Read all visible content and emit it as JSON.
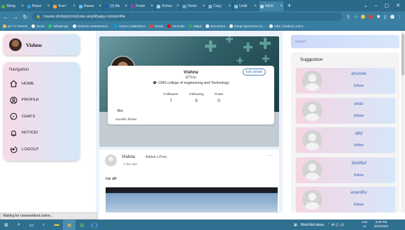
{
  "browser": {
    "tabs": [
      {
        "title": "String",
        "color": "#4caf50"
      },
      {
        "title": "React",
        "color": "#2b9de8"
      },
      {
        "title": "'from'",
        "color": "#f2a33a"
      },
      {
        "title": "Rewar",
        "color": "#66c0f4"
      },
      {
        "title": "(3) Me",
        "color": "#0a66c2"
      },
      {
        "title": "Fronti",
        "color": "#8e44ad"
      },
      {
        "title": "Vishnu",
        "color": "#9ad0ec"
      },
      {
        "title": "Home",
        "color": "#6aa9d0"
      },
      {
        "title": "Copy",
        "color": "#7fb3d5"
      },
      {
        "title": "Untitl",
        "color": "#88c0e0"
      },
      {
        "title": "NEW",
        "color": "#b0d4ea"
      }
    ],
    "active_tab_index": 10,
    "new_tab_label": "+",
    "window_controls": [
      "⌄",
      "–",
      "▢",
      "✕"
    ],
    "url": "master.dmbqq1mmj1oke.amplifyapp.com/profile",
    "bookmarks": [
      {
        "label": "EZ TV Torrent",
        "color": "#f5c542"
      },
      {
        "label": "focus",
        "color": "#ffffff"
      },
      {
        "label": "WhatsApp",
        "color": "#25d366"
      },
      {
        "label": "ReactJs Assessment...",
        "color": "#ffffff"
      },
      {
        "label": "Home | Salesforce",
        "color": "#00a1e0"
      },
      {
        "label": "Gmail",
        "color": "#ea4335"
      },
      {
        "label": "YouTube",
        "color": "#ff0000"
      },
      {
        "label": "Maps",
        "color": "#34a853"
      },
      {
        "label": "Document",
        "color": "#ffffff"
      },
      {
        "label": "Great Speeches Co...",
        "color": "#ffffff"
      },
      {
        "label": "URL | Node.js v19.0...",
        "color": "#ffffff"
      }
    ]
  },
  "user": {
    "name": "Vishnu"
  },
  "nav": {
    "title": "Navigation",
    "items": [
      {
        "label": "HOME",
        "icon": "home-icon"
      },
      {
        "label": "PROFILE",
        "icon": "profile-icon"
      },
      {
        "label": "CHATS",
        "icon": "chat-icon"
      },
      {
        "label": "NOTICE!",
        "icon": "bell-icon"
      },
      {
        "label": "LOGOUT",
        "icon": "logout-icon"
      }
    ]
  },
  "profile": {
    "name": "Vishnu",
    "handle": "@Tinur",
    "college": "CMS college of engineering and Technology",
    "edit_label": "Edit details",
    "stats": [
      {
        "label": "Followers",
        "value": "7"
      },
      {
        "label": "Following",
        "value": "9"
      },
      {
        "label": "Posts",
        "value": "0"
      }
    ],
    "bio_label": "Bio",
    "bio_text": "scientific thinker"
  },
  "post": {
    "author": "Vishnu",
    "action": "Added a Post",
    "time": "1 day ago",
    "text": "hai alll",
    "menu": "..."
  },
  "search": {
    "placeholder": "search"
  },
  "suggestions": {
    "title": "Suggestion",
    "follow_label": "follow",
    "people": [
      "anusree",
      "anas",
      "ajay",
      "fdsfdfsd",
      "anandhu"
    ]
  },
  "status_text": "Waiting for newworldnet.online...",
  "taskbar": {
    "weather": "Watchlist ideas",
    "lang_top": "ENG",
    "lang_bottom": "IN",
    "time": "3:29 PM",
    "date": "5/23/2023"
  }
}
